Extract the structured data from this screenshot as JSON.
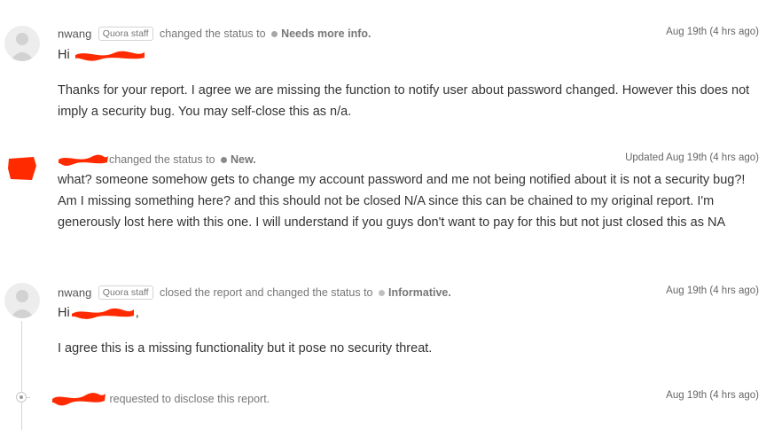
{
  "entries": [
    {
      "user": "nwang",
      "badge": "Quora staff",
      "action": "changed the status to",
      "status": "Needs more info.",
      "timestamp": "Aug 19th (4 hrs ago)",
      "greeting": "Hi",
      "body": "Thanks for your report. I agree we are missing the function to notify user about password changed. However this does not imply a security bug. You may self-close this as n/a."
    },
    {
      "action": "changed the status to",
      "status": "New.",
      "timestamp": "Updated Aug 19th (4 hrs ago)",
      "body": "what? someone somehow gets to change my account password and me not being notified about it is not a security bug?! Am I missing something here? and this should not be closed N/A since this can be chained to my original report. I'm generously lost here with this one. I will understand if you guys don't want to pay for this but not just closed this as NA"
    },
    {
      "user": "nwang",
      "badge": "Quora staff",
      "action": "closed the report and changed the status to",
      "status": "Informative.",
      "timestamp": "Aug 19th (4 hrs ago)",
      "greeting": "Hi",
      "greeting_suffix": ",",
      "body": "I agree this is a missing functionality but it pose no security threat."
    },
    {
      "action": "requested to disclose this report.",
      "timestamp": "Aug 19th (4 hrs ago)"
    }
  ],
  "icons": {
    "avatar": "default-user-avatar-icon",
    "status_dot": "status-dot-icon",
    "timeline_node": "timeline-node-icon"
  },
  "colors": {
    "redaction": "#ff2a00",
    "status_dot": "#a8a8a8",
    "timeline": "#d6d6d6"
  }
}
